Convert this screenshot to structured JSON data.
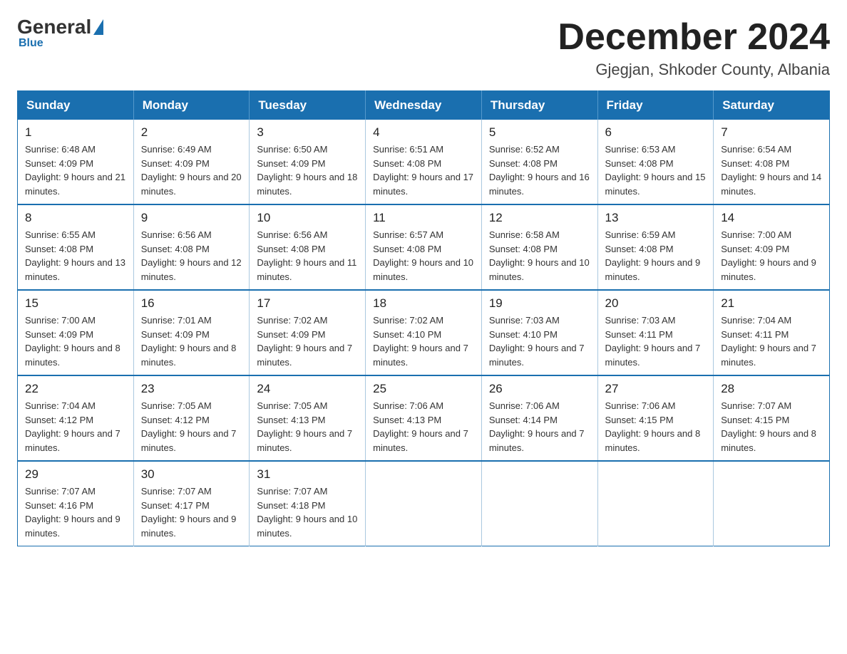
{
  "logo": {
    "general": "General",
    "blue": "Blue"
  },
  "header": {
    "month": "December 2024",
    "location": "Gjegjan, Shkoder County, Albania"
  },
  "weekdays": [
    "Sunday",
    "Monday",
    "Tuesday",
    "Wednesday",
    "Thursday",
    "Friday",
    "Saturday"
  ],
  "weeks": [
    [
      {
        "day": "1",
        "sunrise": "6:48 AM",
        "sunset": "4:09 PM",
        "daylight": "9 hours and 21 minutes."
      },
      {
        "day": "2",
        "sunrise": "6:49 AM",
        "sunset": "4:09 PM",
        "daylight": "9 hours and 20 minutes."
      },
      {
        "day": "3",
        "sunrise": "6:50 AM",
        "sunset": "4:09 PM",
        "daylight": "9 hours and 18 minutes."
      },
      {
        "day": "4",
        "sunrise": "6:51 AM",
        "sunset": "4:08 PM",
        "daylight": "9 hours and 17 minutes."
      },
      {
        "day": "5",
        "sunrise": "6:52 AM",
        "sunset": "4:08 PM",
        "daylight": "9 hours and 16 minutes."
      },
      {
        "day": "6",
        "sunrise": "6:53 AM",
        "sunset": "4:08 PM",
        "daylight": "9 hours and 15 minutes."
      },
      {
        "day": "7",
        "sunrise": "6:54 AM",
        "sunset": "4:08 PM",
        "daylight": "9 hours and 14 minutes."
      }
    ],
    [
      {
        "day": "8",
        "sunrise": "6:55 AM",
        "sunset": "4:08 PM",
        "daylight": "9 hours and 13 minutes."
      },
      {
        "day": "9",
        "sunrise": "6:56 AM",
        "sunset": "4:08 PM",
        "daylight": "9 hours and 12 minutes."
      },
      {
        "day": "10",
        "sunrise": "6:56 AM",
        "sunset": "4:08 PM",
        "daylight": "9 hours and 11 minutes."
      },
      {
        "day": "11",
        "sunrise": "6:57 AM",
        "sunset": "4:08 PM",
        "daylight": "9 hours and 10 minutes."
      },
      {
        "day": "12",
        "sunrise": "6:58 AM",
        "sunset": "4:08 PM",
        "daylight": "9 hours and 10 minutes."
      },
      {
        "day": "13",
        "sunrise": "6:59 AM",
        "sunset": "4:08 PM",
        "daylight": "9 hours and 9 minutes."
      },
      {
        "day": "14",
        "sunrise": "7:00 AM",
        "sunset": "4:09 PM",
        "daylight": "9 hours and 9 minutes."
      }
    ],
    [
      {
        "day": "15",
        "sunrise": "7:00 AM",
        "sunset": "4:09 PM",
        "daylight": "9 hours and 8 minutes."
      },
      {
        "day": "16",
        "sunrise": "7:01 AM",
        "sunset": "4:09 PM",
        "daylight": "9 hours and 8 minutes."
      },
      {
        "day": "17",
        "sunrise": "7:02 AM",
        "sunset": "4:09 PM",
        "daylight": "9 hours and 7 minutes."
      },
      {
        "day": "18",
        "sunrise": "7:02 AM",
        "sunset": "4:10 PM",
        "daylight": "9 hours and 7 minutes."
      },
      {
        "day": "19",
        "sunrise": "7:03 AM",
        "sunset": "4:10 PM",
        "daylight": "9 hours and 7 minutes."
      },
      {
        "day": "20",
        "sunrise": "7:03 AM",
        "sunset": "4:11 PM",
        "daylight": "9 hours and 7 minutes."
      },
      {
        "day": "21",
        "sunrise": "7:04 AM",
        "sunset": "4:11 PM",
        "daylight": "9 hours and 7 minutes."
      }
    ],
    [
      {
        "day": "22",
        "sunrise": "7:04 AM",
        "sunset": "4:12 PM",
        "daylight": "9 hours and 7 minutes."
      },
      {
        "day": "23",
        "sunrise": "7:05 AM",
        "sunset": "4:12 PM",
        "daylight": "9 hours and 7 minutes."
      },
      {
        "day": "24",
        "sunrise": "7:05 AM",
        "sunset": "4:13 PM",
        "daylight": "9 hours and 7 minutes."
      },
      {
        "day": "25",
        "sunrise": "7:06 AM",
        "sunset": "4:13 PM",
        "daylight": "9 hours and 7 minutes."
      },
      {
        "day": "26",
        "sunrise": "7:06 AM",
        "sunset": "4:14 PM",
        "daylight": "9 hours and 7 minutes."
      },
      {
        "day": "27",
        "sunrise": "7:06 AM",
        "sunset": "4:15 PM",
        "daylight": "9 hours and 8 minutes."
      },
      {
        "day": "28",
        "sunrise": "7:07 AM",
        "sunset": "4:15 PM",
        "daylight": "9 hours and 8 minutes."
      }
    ],
    [
      {
        "day": "29",
        "sunrise": "7:07 AM",
        "sunset": "4:16 PM",
        "daylight": "9 hours and 9 minutes."
      },
      {
        "day": "30",
        "sunrise": "7:07 AM",
        "sunset": "4:17 PM",
        "daylight": "9 hours and 9 minutes."
      },
      {
        "day": "31",
        "sunrise": "7:07 AM",
        "sunset": "4:18 PM",
        "daylight": "9 hours and 10 minutes."
      },
      null,
      null,
      null,
      null
    ]
  ]
}
